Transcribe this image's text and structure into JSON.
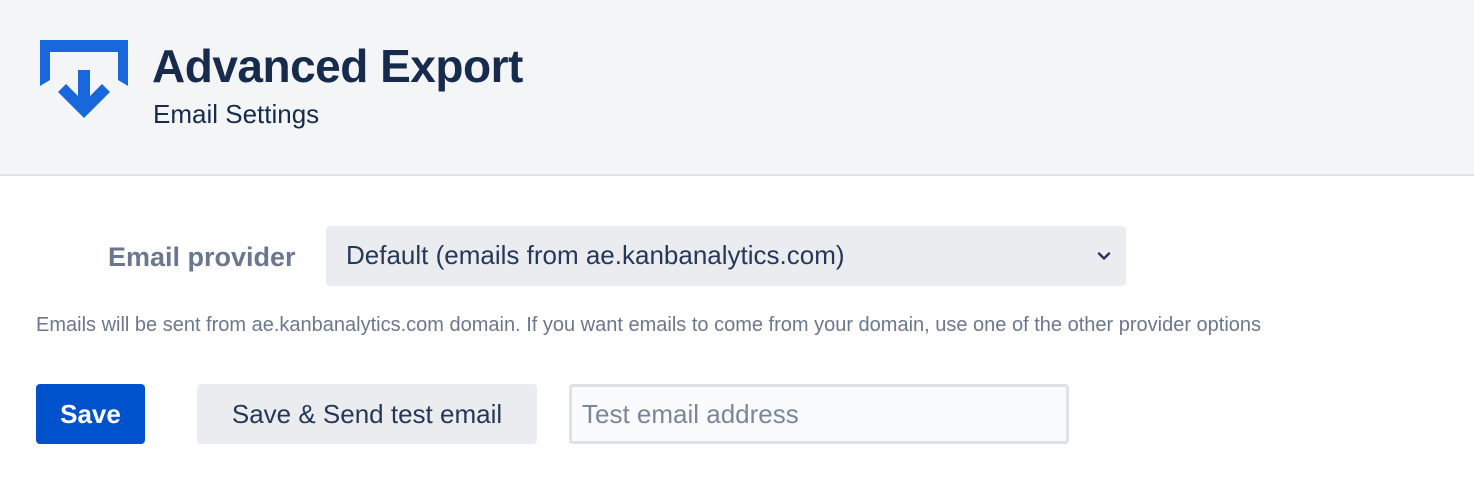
{
  "header": {
    "title": "Advanced Export",
    "subtitle": "Email Settings",
    "logo_icon": "export-download-icon",
    "logo_color": "#1868db"
  },
  "form": {
    "provider_label": "Email provider",
    "provider_selected": "Default (emails from ae.kanbanalytics.com)",
    "provider_chevron_icon": "chevron-down-icon",
    "help_text": "Emails will be sent from ae.kanbanalytics.com domain. If you want emails to come from your domain, use one of the other provider options"
  },
  "actions": {
    "save_label": "Save",
    "test_label": "Save & Send test email",
    "test_input_placeholder": "Test email address",
    "test_input_value": "",
    "primary_color": "#0052cc"
  }
}
